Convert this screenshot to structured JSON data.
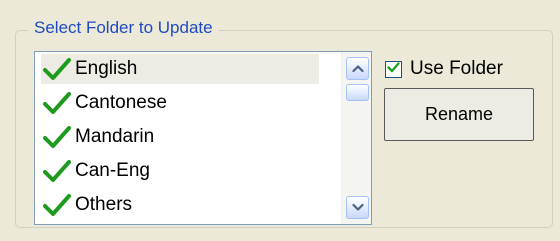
{
  "group": {
    "title": "Select Folder to Update"
  },
  "folders": {
    "items": [
      {
        "label": "English",
        "checked": true,
        "selected": true
      },
      {
        "label": "Cantonese",
        "checked": true,
        "selected": false
      },
      {
        "label": "Mandarin",
        "checked": true,
        "selected": false
      },
      {
        "label": "Can-Eng",
        "checked": true,
        "selected": false
      },
      {
        "label": "Others",
        "checked": true,
        "selected": false
      }
    ]
  },
  "scrollbar": {
    "up_icon": "chevron-up-icon",
    "down_icon": "chevron-down-icon"
  },
  "use_folder": {
    "label": "Use Folder",
    "checked": true
  },
  "rename_button": {
    "label": "Rename"
  },
  "colors": {
    "title_blue": "#1f49c2",
    "check_green": "#1e9b1e",
    "selected_row": "#ecece4",
    "window_bg": "#ece9d8"
  }
}
